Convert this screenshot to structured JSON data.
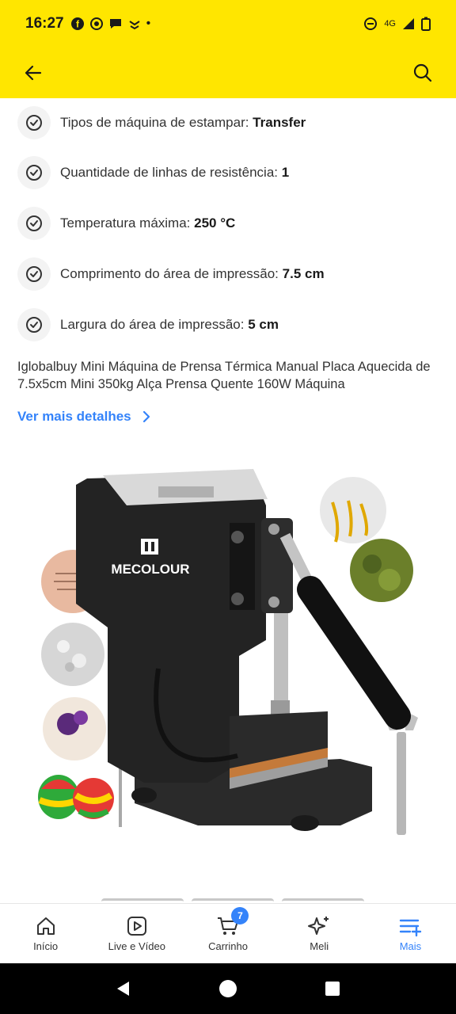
{
  "status_bar": {
    "time": "16:27",
    "network": "4G",
    "dot": "•"
  },
  "app_bar": {
    "back_icon": "arrow-left-icon",
    "search_icon": "search-icon"
  },
  "specs": [
    {
      "label": "Tipos de máquina de estampar: ",
      "value": "Transfer"
    },
    {
      "label": "Quantidade de linhas de resistência: ",
      "value": "1"
    },
    {
      "label": "Temperatura máxima: ",
      "value": "250 °C"
    },
    {
      "label": "Comprimento do área de impressão: ",
      "value": "7.5 cm"
    },
    {
      "label": "Largura do área de impressão: ",
      "value": "5 cm"
    }
  ],
  "description": "Iglobalbuy Mini Máquina de Prensa Térmica Manual Placa Aquecida de 7.5x5cm Mini 350kg Alça Prensa Quente 160W Máquina",
  "more_link": "Ver mais detalhes",
  "product_image": {
    "brand": "MECOLOUR"
  },
  "bottom_nav": {
    "items": [
      {
        "label": "Início",
        "icon": "home-icon"
      },
      {
        "label": "Live e Vídeo",
        "icon": "play-icon"
      },
      {
        "label": "Carrinho",
        "icon": "cart-icon"
      },
      {
        "label": "Meli",
        "icon": "sparkle-icon"
      },
      {
        "label": "Mais",
        "icon": "menu-plus-icon"
      }
    ],
    "cart_count": "7"
  },
  "colors": {
    "brand_yellow": "#ffe600",
    "link_blue": "#3483fa"
  }
}
